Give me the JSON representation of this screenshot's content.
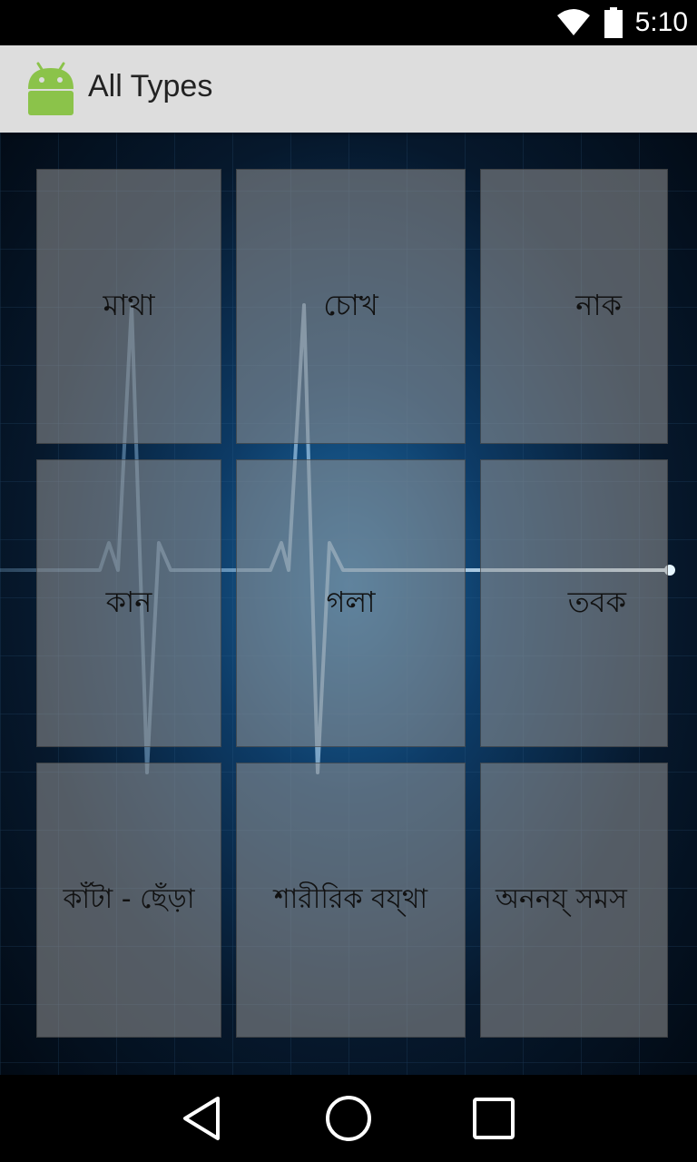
{
  "status_bar": {
    "time": "5:10"
  },
  "app_bar": {
    "title": "All Types"
  },
  "tiles": [
    {
      "label": "মাথা"
    },
    {
      "label": "চোখ"
    },
    {
      "label": "নাক"
    },
    {
      "label": "কান"
    },
    {
      "label": "গলা"
    },
    {
      "label": "তবক"
    },
    {
      "label": "কাঁটা - ছেঁড়া"
    },
    {
      "label": "শারীরিক বয্থা"
    },
    {
      "label": "অননয্ সমস"
    }
  ],
  "nav_bar": {
    "back": "back-icon",
    "home": "home-icon",
    "recents": "recents-icon"
  }
}
